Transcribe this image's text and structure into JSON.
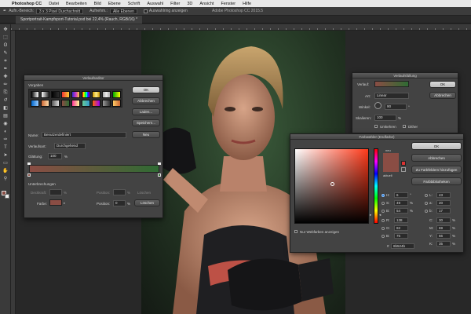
{
  "menu": {
    "apple": "",
    "app": "Photoshop CC",
    "items": [
      "Datei",
      "Bearbeiten",
      "Bild",
      "Ebene",
      "Schrift",
      "Auswahl",
      "Filter",
      "3D",
      "Ansicht",
      "Fenster",
      "Hilfe"
    ]
  },
  "options": {
    "title": "Adobe Photoshop CC 2015.5",
    "aufnahme_label": "Aufn.-Bereich:",
    "aufnahme_value": "3 x 3 Pixel Durchschnitt",
    "aufnehmen_label": "Aufnehm.:",
    "aufnehmen_value": "Alle Ebenen",
    "ring_label": "Auswahlring anzeigen"
  },
  "tab": {
    "label": "Sportportrait-Kampfsport-Tutorial.psd bei 22,4% (Rauch, RGB/16) *"
  },
  "toolbar": {
    "icons": [
      "move-icon",
      "marquee-icon",
      "lasso-icon",
      "quick-select-icon",
      "crop-icon",
      "eyedropper-icon",
      "healing-icon",
      "brush-icon",
      "stamp-icon",
      "history-brush-icon",
      "eraser-icon",
      "gradient-icon",
      "blur-icon",
      "dodge-icon",
      "pen-icon",
      "type-icon",
      "path-select-icon",
      "shape-icon",
      "hand-icon",
      "zoom-icon"
    ],
    "glyphs": [
      "✥",
      "⬚",
      "ʘ",
      "✎",
      "⌗",
      "✒",
      "✚",
      "✏",
      "⎘",
      "↺",
      "◧",
      "▤",
      "◉",
      "◐",
      "✑",
      "T",
      "➤",
      "▭",
      "✋",
      "⚲"
    ]
  },
  "gradient_editor": {
    "title": "Verlaufseditor",
    "presets_label": "Vorgaben",
    "ok": "OK",
    "cancel": "Abbrechen",
    "load": "Laden...",
    "save": "Speichern...",
    "name_label": "Name:",
    "name_value": "Benutzerdefiniert",
    "new": "Neu",
    "type_label": "Verlaufsart:",
    "type_value": "Durchgehend",
    "smooth_label": "Glättung:",
    "smooth_value": "100",
    "smooth_unit": "%",
    "stops_label": "Unterbrechungen",
    "opacity_label": "Deckkraft:",
    "opacity_unit": "%",
    "opacity_pos_label": "Position:",
    "opacity_pos_unit": "%",
    "opacity_delete": "Löschen",
    "color_label": "Farbe:",
    "color_pos_label": "Position:",
    "color_pos_value": "0",
    "color_pos_unit": "%",
    "color_delete": "Löschen",
    "color_start": "#8a4d44",
    "color_end": "#2f6b33"
  },
  "gradient_overlay": {
    "title": "Verlaufsfüllung",
    "gradient_label": "Verlauf:",
    "style_label": "Art:",
    "style_value": "Linear",
    "angle_label": "Winkel:",
    "angle_value": "90",
    "angle_unit": "°",
    "scale_label": "Skalieren:",
    "scale_value": "100",
    "scale_unit": "%",
    "reverse_label": "Umkehren",
    "dither_label": "Dither",
    "ok": "OK",
    "cancel": "Abbrechen"
  },
  "color_picker": {
    "title": "Farbwähler (Endfarbe)",
    "ok": "OK",
    "cancel": "Abbrechen",
    "add_swatch": "Zu Farbfeldern hinzufügen",
    "libraries": "Farbbibliotheken",
    "new_label": "neu",
    "current_label": "aktuell",
    "new_color": "#8a4d44",
    "current_color": "#8a4d44",
    "web_only_label": "Nur Webfarben anzeigen",
    "fields": {
      "H": {
        "label": "H:",
        "value": "6",
        "unit": "°"
      },
      "S": {
        "label": "S:",
        "value": "49",
        "unit": "%"
      },
      "B": {
        "label": "B:",
        "value": "54",
        "unit": "%"
      },
      "R": {
        "label": "R:",
        "value": "138",
        "unit": ""
      },
      "G": {
        "label": "G:",
        "value": "82",
        "unit": ""
      },
      "Bl": {
        "label": "B:",
        "value": "75",
        "unit": ""
      },
      "L": {
        "label": "L:",
        "value": "43",
        "unit": ""
      },
      "a": {
        "label": "a:",
        "value": "20",
        "unit": ""
      },
      "b": {
        "label": "b:",
        "value": "17",
        "unit": ""
      },
      "C": {
        "label": "C:",
        "value": "30",
        "unit": "%"
      },
      "M": {
        "label": "M:",
        "value": "69",
        "unit": "%"
      },
      "Y": {
        "label": "Y:",
        "value": "66",
        "unit": "%"
      },
      "K": {
        "label": "K:",
        "value": "35",
        "unit": "%"
      }
    },
    "hex_label": "#",
    "hex_value": "8b524b"
  }
}
